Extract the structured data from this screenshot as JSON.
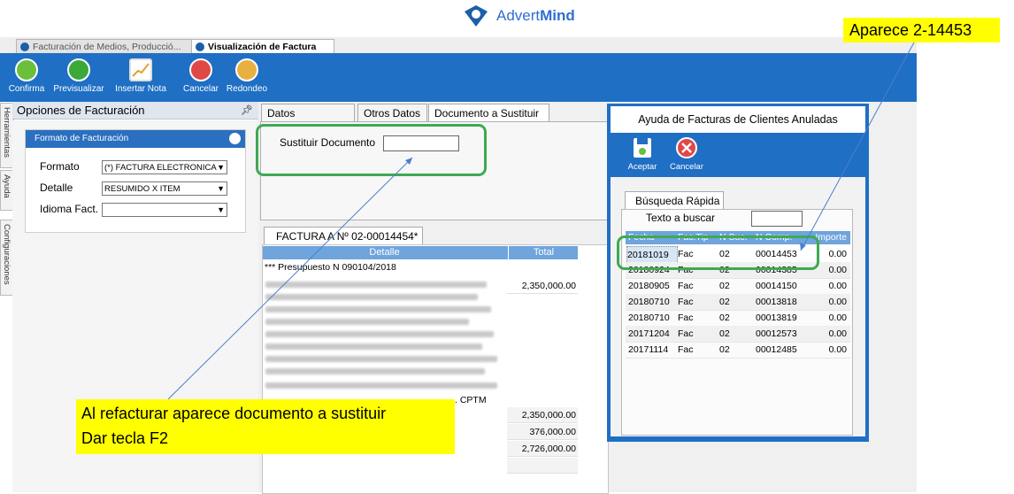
{
  "brand": {
    "name_part1": "Advert",
    "name_part2": "Mind"
  },
  "doc_tabs": [
    {
      "label": "Facturación de Medios, Producció..."
    },
    {
      "label": "Visualización de Factura"
    }
  ],
  "ribbon": {
    "buttons": [
      {
        "label": "Confirma",
        "icon": "check-icon",
        "color": "#6abf3b"
      },
      {
        "label": "Previsualizar",
        "icon": "play-icon",
        "color": "#3aa93a"
      },
      {
        "label": "Insertar Nota",
        "icon": "chart-icon",
        "color": "#e0a030"
      },
      {
        "label": "Cancelar",
        "icon": "close-icon",
        "color": "#e04848"
      },
      {
        "label": "Redondeo",
        "icon": "coins-icon",
        "color": "#e8b040"
      }
    ]
  },
  "side_tabs": [
    "Herramientas",
    "Ayuda",
    "Configuraciones"
  ],
  "left_panel": {
    "title": "Opciones de Facturación",
    "pin": "ᵖ",
    "format_box_title": "Formato de Facturación",
    "fields": [
      {
        "label": "Formato",
        "value": "(*) FACTURA ELECTRONICA"
      },
      {
        "label": "Detalle",
        "value": "RESUMIDO X ITEM"
      },
      {
        "label": "Idioma Fact.",
        "value": ""
      }
    ]
  },
  "main_tabs": [
    {
      "label": "Datos Principales"
    },
    {
      "label": "Otros Datos"
    },
    {
      "label": "Documento a Sustituir"
    }
  ],
  "sustituir": {
    "label": "Sustituir Documento",
    "value": ""
  },
  "invoice": {
    "tab_label": "FACTURA A Nº 02-00014454*",
    "col_detalle": "Detalle",
    "col_total": "Total",
    "first_line": "*** Presupuesto N 090104/2018",
    "first_amount": "2,350,000.00",
    "trailing_text": ". CPTM",
    "totals": [
      "2,350,000.00",
      "376,000.00",
      "2,726,000.00"
    ]
  },
  "modal": {
    "title": "Ayuda de Facturas de Clientes Anuladas",
    "accept_label": "Aceptar",
    "cancel_label": "Cancelar",
    "tab_label": "Búsqueda Rápida",
    "search_label": "Texto a buscar",
    "search_value": "",
    "columns": [
      "Fecha",
      "Fac.Tip",
      "N Suc.",
      "N Comp.",
      "Importe"
    ],
    "rows": [
      {
        "fecha": "20181019",
        "tipo": "Fac",
        "suc": "02",
        "comp": "00014453",
        "importe": "0.00"
      },
      {
        "fecha": "20180924",
        "tipo": "Fac",
        "suc": "02",
        "comp": "00014385",
        "importe": "0.00"
      },
      {
        "fecha": "20180905",
        "tipo": "Fac",
        "suc": "02",
        "comp": "00014150",
        "importe": "0.00"
      },
      {
        "fecha": "20180710",
        "tipo": "Fac",
        "suc": "02",
        "comp": "00013818",
        "importe": "0.00"
      },
      {
        "fecha": "20180710",
        "tipo": "Fac",
        "suc": "02",
        "comp": "00013819",
        "importe": "0.00"
      },
      {
        "fecha": "20171204",
        "tipo": "Fac",
        "suc": "02",
        "comp": "00012573",
        "importe": "0.00"
      },
      {
        "fecha": "20171114",
        "tipo": "Fac",
        "suc": "02",
        "comp": "00012485",
        "importe": "0.00"
      }
    ]
  },
  "callouts": {
    "left_line1": "Al refacturar aparece documento a sustituir",
    "left_line2": "Dar tecla F2",
    "right": "Aparece 2-14453"
  },
  "colors": {
    "ribbon": "#1f6fc4",
    "header_row": "#6fa4dc",
    "highlight": "#3daa52",
    "callout": "#ffff00"
  }
}
